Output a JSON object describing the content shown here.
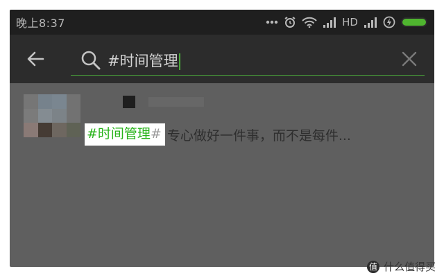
{
  "status_bar": {
    "time": "晚上8:37",
    "network": "HD",
    "icons": [
      "dots-icon",
      "alarm-icon",
      "wifi-icon",
      "signal-icon",
      "signal-icon",
      "charging-icon",
      "battery-icon"
    ],
    "battery_color": "#4fb52f"
  },
  "search": {
    "query": "#时间管理",
    "accent_color": "#4aa83a",
    "icons": [
      "back-arrow-icon",
      "search-icon",
      "clear-icon"
    ]
  },
  "results": [
    {
      "hashtag": "#时间管理",
      "hashtag_close": "#",
      "snippet": "专心做好一件事，而不是每件..."
    }
  ],
  "watermark": {
    "logo": "值",
    "text": "什么值得买"
  }
}
